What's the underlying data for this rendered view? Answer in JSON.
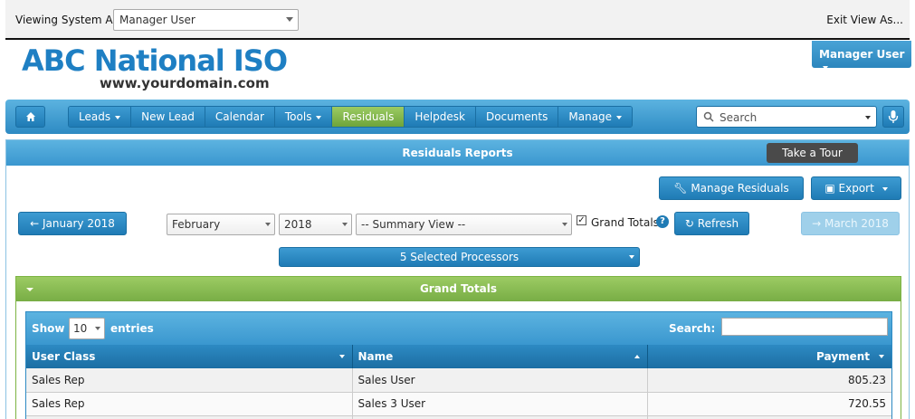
{
  "viewbar": {
    "label": "Viewing System As:",
    "selected_user": "Manager User",
    "exit_label": "Exit View As..."
  },
  "brand": {
    "logo_text": "ABC National ISO",
    "domain": "www.yourdomain.com",
    "user_menu": "Manager User"
  },
  "nav": {
    "items": [
      {
        "label": "Leads",
        "dropdown": true
      },
      {
        "label": "New Lead",
        "dropdown": false
      },
      {
        "label": "Calendar",
        "dropdown": false
      },
      {
        "label": "Tools",
        "dropdown": true
      },
      {
        "label": "Residuals",
        "dropdown": false,
        "active": true
      },
      {
        "label": "Helpdesk",
        "dropdown": false
      },
      {
        "label": "Documents",
        "dropdown": false
      },
      {
        "label": "Manage",
        "dropdown": true
      }
    ],
    "search_placeholder": "Search"
  },
  "panel": {
    "title": "Residuals Reports",
    "tour_label": "Take a Tour",
    "manage_residuals_label": "Manage Residuals",
    "export_label": "Export",
    "prev_month_label": "January 2018",
    "next_month_label": "March 2018",
    "month_value": "February",
    "year_value": "2018",
    "view_value": "-- Summary View --",
    "grand_totals_checkbox_label": "Grand Totals",
    "grand_totals_checked": true,
    "refresh_label": "Refresh",
    "processors_label": "5 Selected Processors"
  },
  "grand_totals": {
    "title": "Grand Totals",
    "table": {
      "show_label": "Show",
      "length_value": "10",
      "entries_label": "entries",
      "search_label": "Search:",
      "columns": [
        "User Class",
        "Name",
        "Payment"
      ],
      "rows": [
        [
          "Sales Rep",
          "Sales User",
          "805.23"
        ],
        [
          "Sales Rep",
          "Sales 3 User",
          "720.55"
        ]
      ]
    }
  },
  "colors": {
    "accent_blue": "#2d8ac3",
    "active_green": "#8bc34a",
    "logo_blue": "#1e7fc3"
  }
}
